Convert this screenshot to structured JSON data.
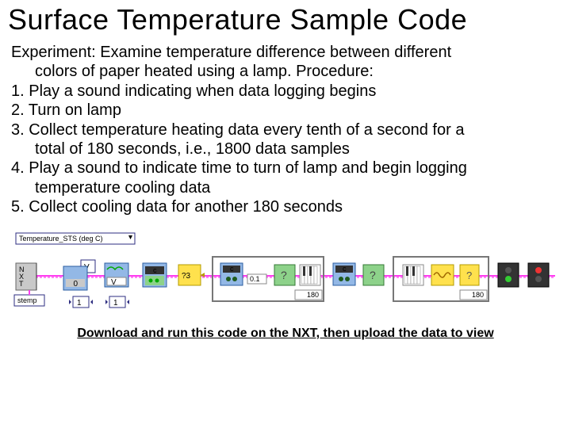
{
  "title": "Surface Temperature Sample Code",
  "intro": "Experiment: Examine temperature difference between different",
  "intro2": "colors of paper heated using a lamp.  Procedure:",
  "steps": {
    "s1": "1. Play a sound indicating when data logging begins",
    "s2": "2. Turn on lamp",
    "s3": "3. Collect temperature heating data every tenth of a second for a",
    "s3b": "total of 180 seconds, i.e., 1800 data samples",
    "s4": "4. Play a sound to indicate time to turn of lamp and begin logging",
    "s4b": "temperature cooling data",
    "s5": "5. Collect cooling data for another 180 seconds"
  },
  "diagram": {
    "sensor_label": "Temperature_STS (deg C)",
    "file_label": "stemp",
    "const_0": "0",
    "const_v": "V",
    "const_1a": "1",
    "const_1b": "1",
    "wait_val": "0.1",
    "loop1": "180",
    "loop2": "180",
    "q1": "?",
    "q2": "?",
    "c1": "c",
    "c2": "c",
    "c3": "c",
    "wait_expr": "?3"
  },
  "download_text": "Download and run this code on the NXT, then upload the data to view"
}
